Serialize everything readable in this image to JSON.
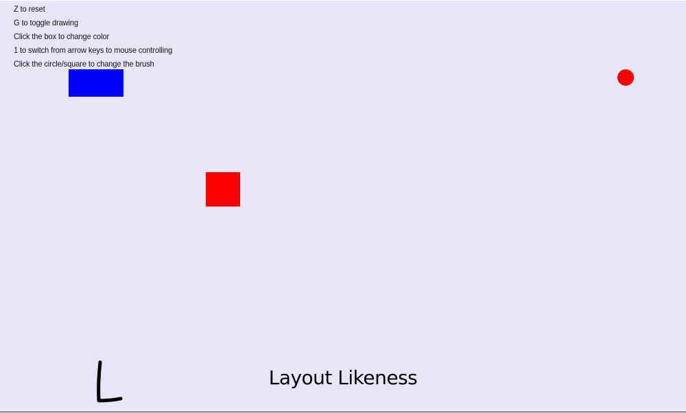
{
  "instructions": [
    "Z to reset",
    "G to toggle drawing",
    "Click the box to change color",
    "1 to switch from arrow keys to mouse controlling",
    "Click the circle/square to change the brush"
  ],
  "colors": {
    "canvas_background": "#e9e5f8",
    "color_box": "#0000ff",
    "brush_indicator": "#ff0000",
    "player": "#ff0000",
    "drawing_stroke": "#000000"
  },
  "brush_shape": "circle",
  "caption": "Layout Likeness",
  "icons": {
    "drawn_letter": "handwritten-L-stroke"
  }
}
